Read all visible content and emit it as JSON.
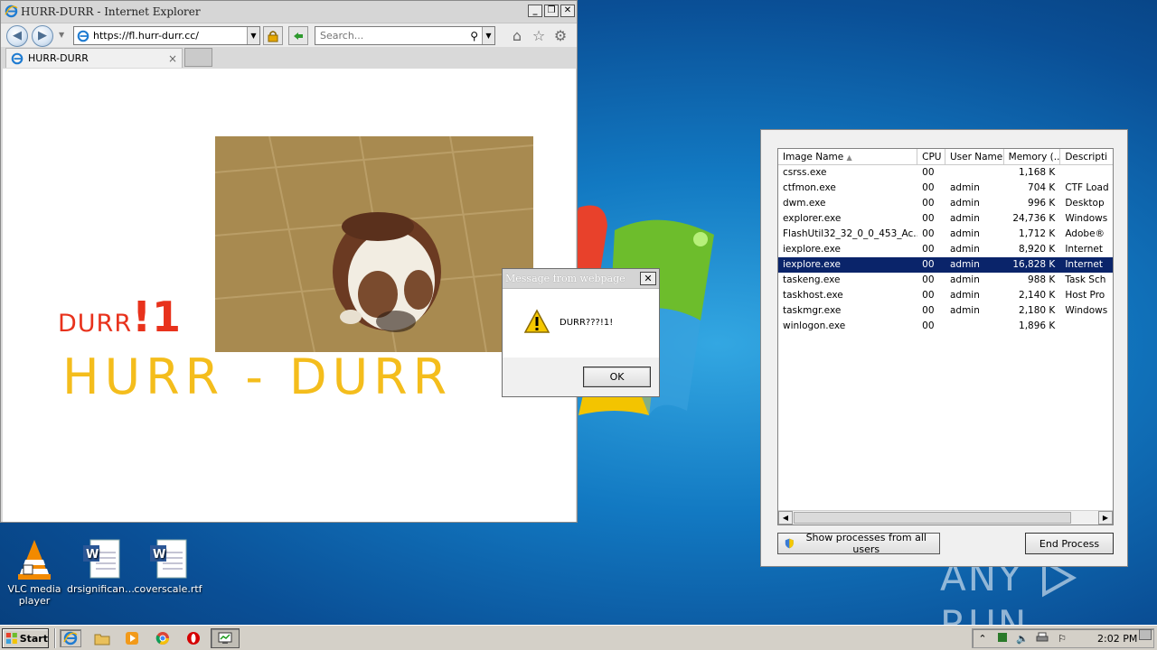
{
  "ie": {
    "window_title": "HURR-DURR - Internet Explorer",
    "address_url": "https://fl.hurr-durr.cc/",
    "search_placeholder": "Search...",
    "tab_label": "HURR-DURR",
    "tab_close": "×",
    "caption_minimize": "_",
    "caption_restore": "❐",
    "caption_close": "✕",
    "page": {
      "durr_text": "DURR",
      "durr_mark": "!1",
      "hurr_durr_text": "HURR - DURR"
    }
  },
  "alert": {
    "title": "Message from webpage",
    "message": "DURR???!1!",
    "ok_label": "OK",
    "close_label": "✕"
  },
  "taskmgr": {
    "columns": [
      "Image Name",
      "CPU",
      "User Name",
      "Memory (...",
      "Descripti"
    ],
    "processes": [
      {
        "name": "csrss.exe",
        "cpu": "00",
        "user": "",
        "mem": "1,168 K",
        "desc": ""
      },
      {
        "name": "ctfmon.exe",
        "cpu": "00",
        "user": "admin",
        "mem": "704 K",
        "desc": "CTF Load"
      },
      {
        "name": "dwm.exe",
        "cpu": "00",
        "user": "admin",
        "mem": "996 K",
        "desc": "Desktop"
      },
      {
        "name": "explorer.exe",
        "cpu": "00",
        "user": "admin",
        "mem": "24,736 K",
        "desc": "Windows"
      },
      {
        "name": "FlashUtil32_32_0_0_453_Ac...",
        "cpu": "00",
        "user": "admin",
        "mem": "1,712 K",
        "desc": "Adobe®"
      },
      {
        "name": "iexplore.exe",
        "cpu": "00",
        "user": "admin",
        "mem": "8,920 K",
        "desc": "Internet"
      },
      {
        "name": "iexplore.exe",
        "cpu": "00",
        "user": "admin",
        "mem": "16,828 K",
        "desc": "Internet"
      },
      {
        "name": "taskeng.exe",
        "cpu": "00",
        "user": "admin",
        "mem": "988 K",
        "desc": "Task Sch"
      },
      {
        "name": "taskhost.exe",
        "cpu": "00",
        "user": "admin",
        "mem": "2,140 K",
        "desc": "Host Pro"
      },
      {
        "name": "taskmgr.exe",
        "cpu": "00",
        "user": "admin",
        "mem": "2,180 K",
        "desc": "Windows"
      },
      {
        "name": "winlogon.exe",
        "cpu": "00",
        "user": "",
        "mem": "1,896 K",
        "desc": ""
      }
    ],
    "selected_index": 6,
    "show_all_label": "Show processes from all users",
    "end_process_label": "End Process"
  },
  "desktop": {
    "icons": [
      {
        "label_1": "VLC media",
        "label_2": "player",
        "icon": "vlc-icon"
      },
      {
        "label_1": "drsignificant...",
        "icon": "word-doc-icon"
      },
      {
        "label_1": "coverscale.rtf",
        "icon": "word-doc-icon"
      }
    ],
    "watermark_left": "ANY",
    "watermark_right": "RUN"
  },
  "taskbar": {
    "start_label": "Start",
    "clock": "2:02 PM",
    "quick_launch": [
      "ie-icon",
      "folder-icon",
      "media-player-icon",
      "chrome-icon",
      "opera-icon"
    ],
    "tray": [
      "chevron-up-icon",
      "network-icon",
      "volume-icon",
      "printer-icon",
      "flag-icon"
    ]
  },
  "colors": {
    "durr_red": "#e8321c",
    "hurr_yellow": "#f4bd1c",
    "selection_blue": "#0a246a"
  }
}
